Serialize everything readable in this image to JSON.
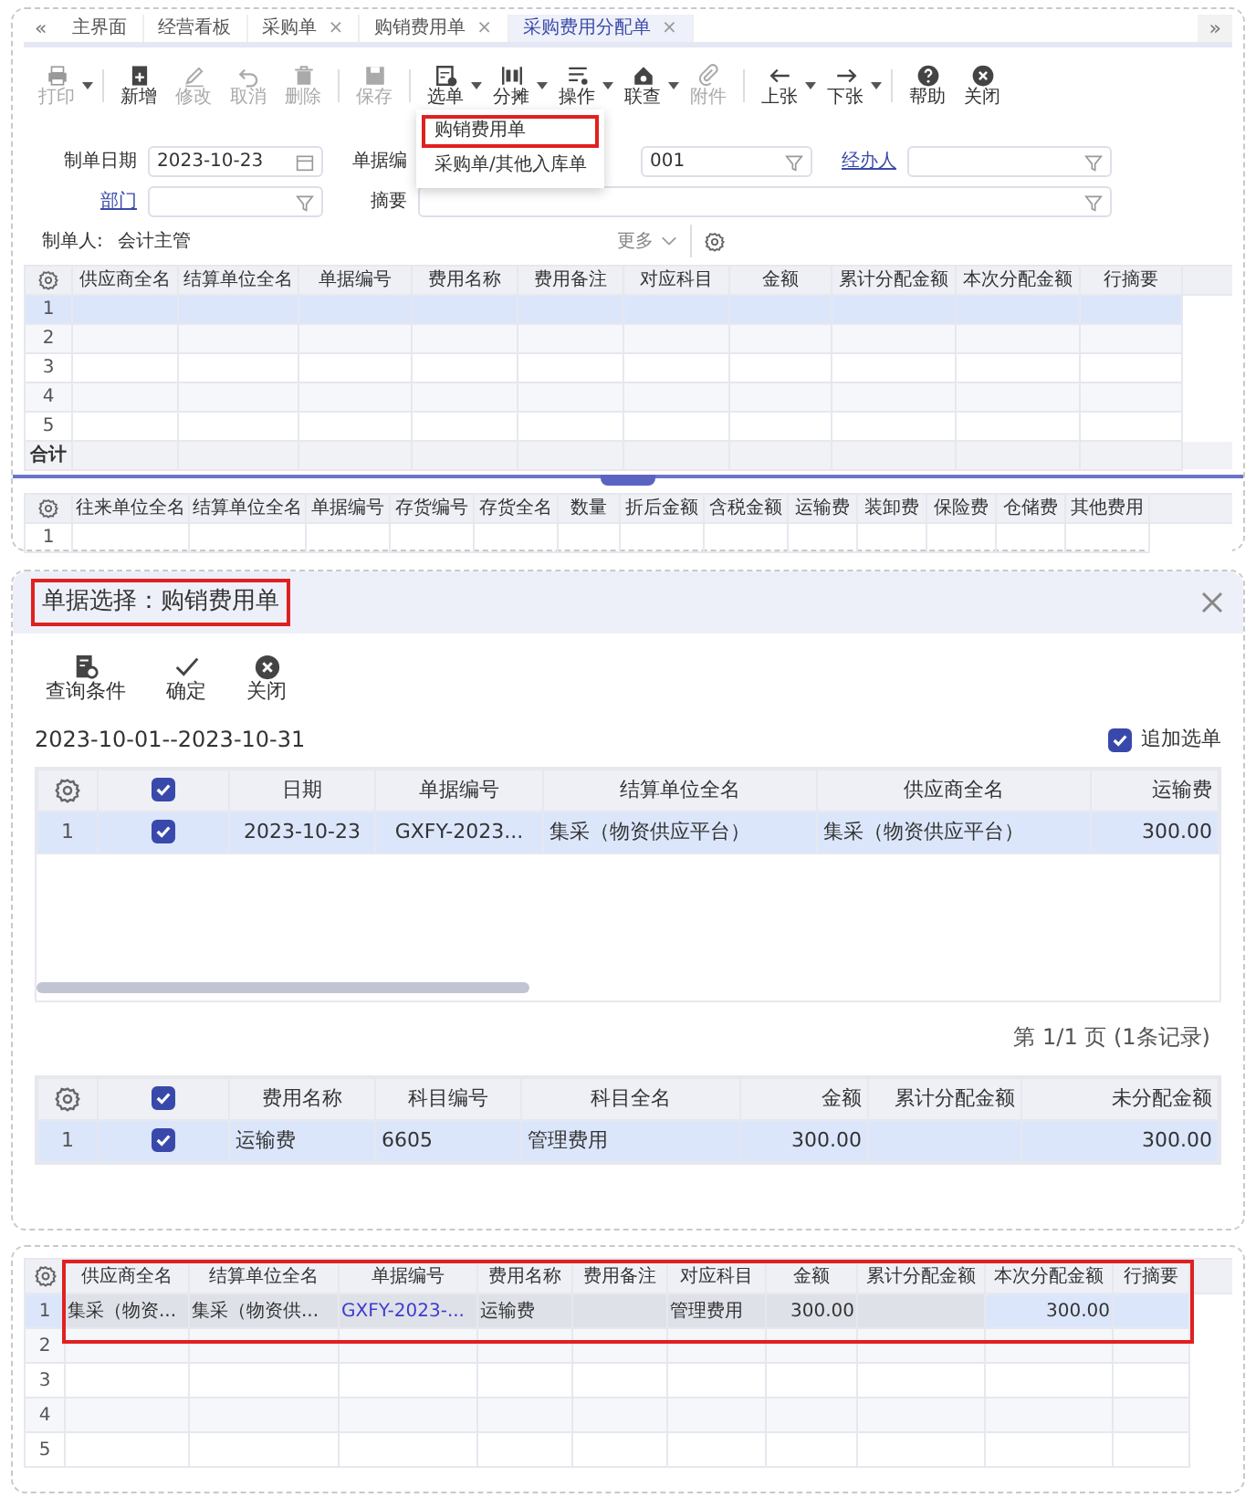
{
  "tab_bar": {
    "back": "«",
    "forward": "»",
    "tabs": [
      {
        "label": "主界面",
        "selected": false
      },
      {
        "label": "经营看板",
        "selected": false
      },
      {
        "label": "采购单",
        "close": "×",
        "selected": false
      },
      {
        "label": "购销费用单",
        "close": "×",
        "selected": false
      },
      {
        "label": "采购费用分配单",
        "close": "×",
        "selected": true
      }
    ]
  },
  "toolbar": [
    {
      "label": "打印",
      "disabled": true,
      "dropdown": true
    },
    {
      "label": "新增",
      "disabled": false,
      "dropdown": false
    },
    {
      "label": "修改",
      "disabled": true,
      "dropdown": false
    },
    {
      "label": "取消",
      "disabled": true,
      "dropdown": false
    },
    {
      "label": "删除",
      "disabled": true,
      "dropdown": false
    },
    {
      "label": "保存",
      "disabled": true,
      "dropdown": false
    },
    {
      "label": "选单",
      "disabled": false,
      "dropdown": true
    },
    {
      "label": "分摊",
      "disabled": false,
      "dropdown": true
    },
    {
      "label": "操作",
      "disabled": false,
      "dropdown": true
    },
    {
      "label": "联查",
      "disabled": false,
      "dropdown": true
    },
    {
      "label": "附件",
      "disabled": true,
      "dropdown": false
    },
    {
      "label": "上张",
      "disabled": false,
      "dropdown": true
    },
    {
      "label": "下张",
      "disabled": false,
      "dropdown": true
    },
    {
      "label": "帮助",
      "disabled": false,
      "dropdown": false
    },
    {
      "label": "关闭",
      "disabled": false,
      "dropdown": false
    }
  ],
  "select_menu": {
    "items": [
      {
        "label": "购销费用单",
        "highlighted": true
      },
      {
        "label": "采购单/其他入库单",
        "highlighted": false
      }
    ]
  },
  "form": {
    "fields": [
      {
        "label": "制单日期",
        "value": "2023-10-23",
        "kind": "date",
        "link": false
      },
      {
        "label": "单据编",
        "value": "001",
        "kind": "filter",
        "link": false
      },
      {
        "label": "经办人",
        "kind": "filter",
        "link": true
      },
      {
        "label": "部门",
        "kind": "filter",
        "link": true
      },
      {
        "label": "摘要",
        "kind": "filter",
        "link": false
      }
    ],
    "maker_label": "制单人:",
    "maker": "会计主管",
    "more": "更多"
  },
  "allocation_grid": {
    "columns": [
      "供应商全名",
      "结算单位全名",
      "单据编号",
      "费用名称",
      "费用备注",
      "对应科目",
      "金额",
      "累计分配金额",
      "本次分配金额",
      "行摘要"
    ],
    "rows": [
      {
        "number": "1",
        "selected": true
      },
      {
        "number": "2",
        "selected": false
      },
      {
        "number": "3",
        "selected": false
      },
      {
        "number": "4",
        "selected": false
      },
      {
        "number": "5",
        "selected": false
      }
    ],
    "total_label": "合计"
  },
  "inventory_grid": {
    "columns": [
      "往来单位全名",
      "结算单位全名",
      "单据编号",
      "存货编号",
      "存货全名",
      "数量",
      "折后金额",
      "含税金额",
      "运输费",
      "装卸费",
      "保险费",
      "仓储费",
      "其他费用"
    ],
    "rows": [
      {
        "number": "1"
      }
    ]
  },
  "dialog": {
    "title": "单据选择：购销费用单",
    "highlighted": true,
    "toolbar": [
      "查询条件",
      "确定",
      "关闭"
    ],
    "date_range": "2023-10-01--2023-10-31",
    "append_select": {
      "label": "追加选单",
      "checked": true
    },
    "document_grid": {
      "all_checked": true,
      "columns": [
        {
          "label": "日期",
          "kind": "center"
        },
        {
          "label": "单据编号",
          "kind": "center"
        },
        {
          "label": "结算单位全名",
          "kind": "text"
        },
        {
          "label": "供应商全名",
          "kind": "text"
        },
        {
          "label": "运输费",
          "kind": "amount"
        }
      ],
      "rows": [
        {
          "number": "1",
          "checked": true,
          "selected": true,
          "cells": [
            "2023-10-23",
            "GXFY-2023...",
            "集采（物资供应平台）",
            "集采（物资供应平台）",
            "300.00"
          ]
        }
      ]
    },
    "pager": "第 1/1 页 (1条记录)",
    "detail_grid": {
      "all_checked": true,
      "columns": [
        {
          "label": "费用名称",
          "kind": "text"
        },
        {
          "label": "科目编号",
          "kind": "text"
        },
        {
          "label": "科目全名",
          "kind": "text"
        },
        {
          "label": "金额",
          "kind": "amount"
        },
        {
          "label": "累计分配金额",
          "kind": "amount"
        },
        {
          "label": "未分配金额",
          "kind": "amount"
        }
      ],
      "rows": [
        {
          "number": "1",
          "checked": true,
          "selected": true,
          "cells": [
            "运输费",
            "6605",
            "管理费用",
            "300.00",
            "",
            "300.00"
          ]
        }
      ]
    }
  },
  "result_grid": {
    "highlighted": true,
    "columns": [
      {
        "label": "供应商全名",
        "kind": "text",
        "editable": false
      },
      {
        "label": "结算单位全名",
        "kind": "text",
        "editable": false
      },
      {
        "label": "单据编号",
        "kind": "link",
        "editable": false
      },
      {
        "label": "费用名称",
        "kind": "text",
        "editable": false
      },
      {
        "label": "费用备注",
        "kind": "text",
        "editable": false
      },
      {
        "label": "对应科目",
        "kind": "text",
        "editable": false
      },
      {
        "label": "金额",
        "kind": "amount",
        "editable": false
      },
      {
        "label": "累计分配金额",
        "kind": "amount",
        "editable": false
      },
      {
        "label": "本次分配金额",
        "kind": "amount",
        "editable": true
      },
      {
        "label": "行摘要",
        "kind": "text",
        "editable": true
      }
    ],
    "rows": [
      {
        "number": "1",
        "selected": true,
        "cells": [
          "集采（物资...",
          "集采（物资供...",
          "GXFY-2023-...",
          "运输费",
          "",
          "管理费用",
          "300.00",
          "",
          "300.00",
          ""
        ]
      },
      {
        "number": "2",
        "selected": false,
        "cells": []
      },
      {
        "number": "3",
        "selected": false,
        "cells": []
      },
      {
        "number": "4",
        "selected": false,
        "cells": []
      },
      {
        "number": "5",
        "selected": false,
        "cells": []
      }
    ]
  }
}
